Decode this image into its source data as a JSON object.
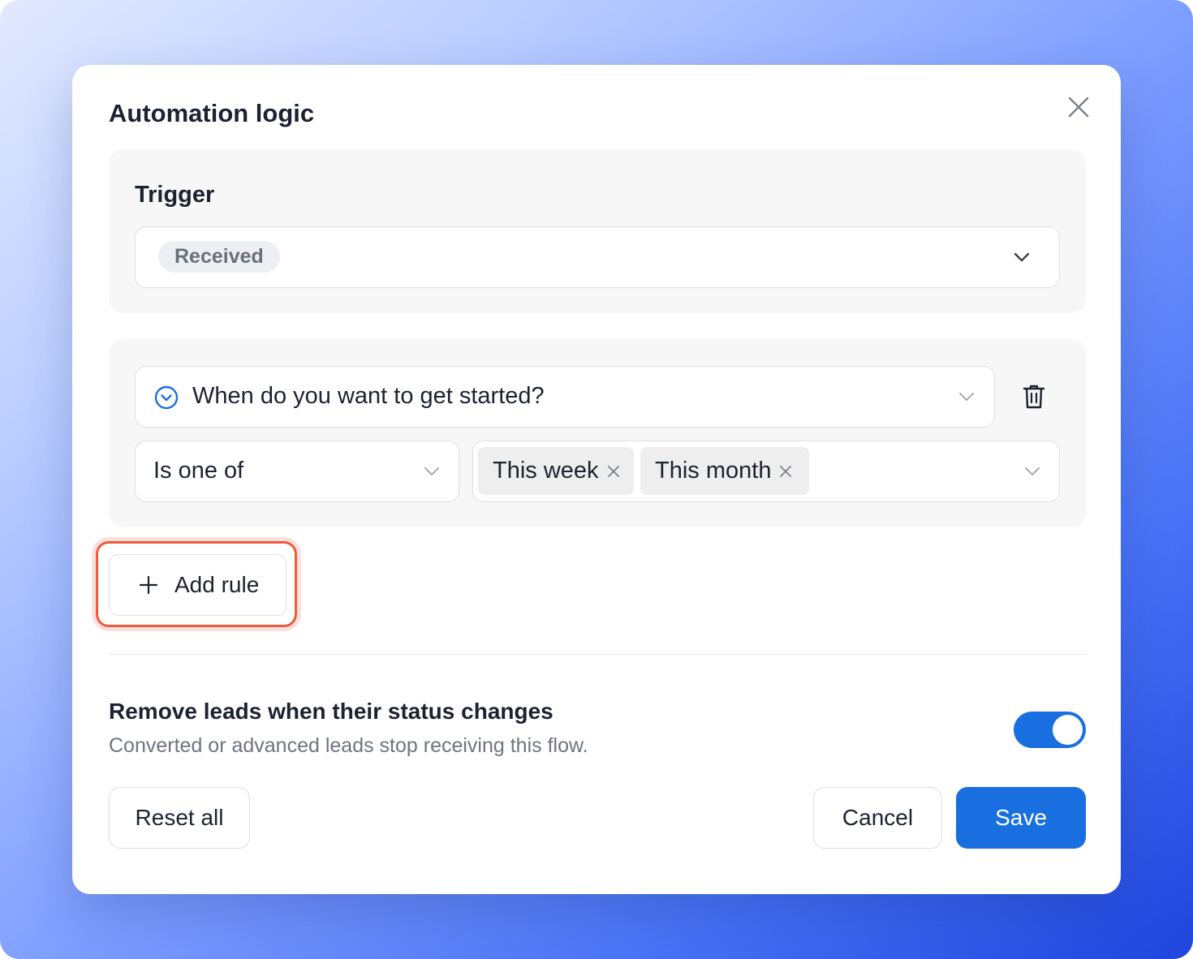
{
  "modal": {
    "title": "Automation logic",
    "close_icon": "close-icon"
  },
  "trigger": {
    "label": "Trigger",
    "selected_chip": "Received",
    "dropdown_icon": "chevron-down-icon"
  },
  "rule": {
    "field_icon": "chevron-circle-icon",
    "field_value": "When do you want to get started?",
    "delete_icon": "trash-icon",
    "operator": "Is one of",
    "values": [
      "This week",
      "This month"
    ]
  },
  "add_rule": {
    "label": "Add rule",
    "icon": "plus-icon",
    "highlighted": true
  },
  "setting": {
    "title": "Remove leads when their status changes",
    "description": "Converted or advanced leads stop receiving this flow.",
    "toggle_on": true
  },
  "footer": {
    "reset_label": "Reset all",
    "cancel_label": "Cancel",
    "save_label": "Save"
  },
  "colors": {
    "accent": "#1a6fe0",
    "highlight": "#ef5a3d",
    "panel_bg": "#f7f7f7",
    "chip_bg": "#eeeff2"
  }
}
